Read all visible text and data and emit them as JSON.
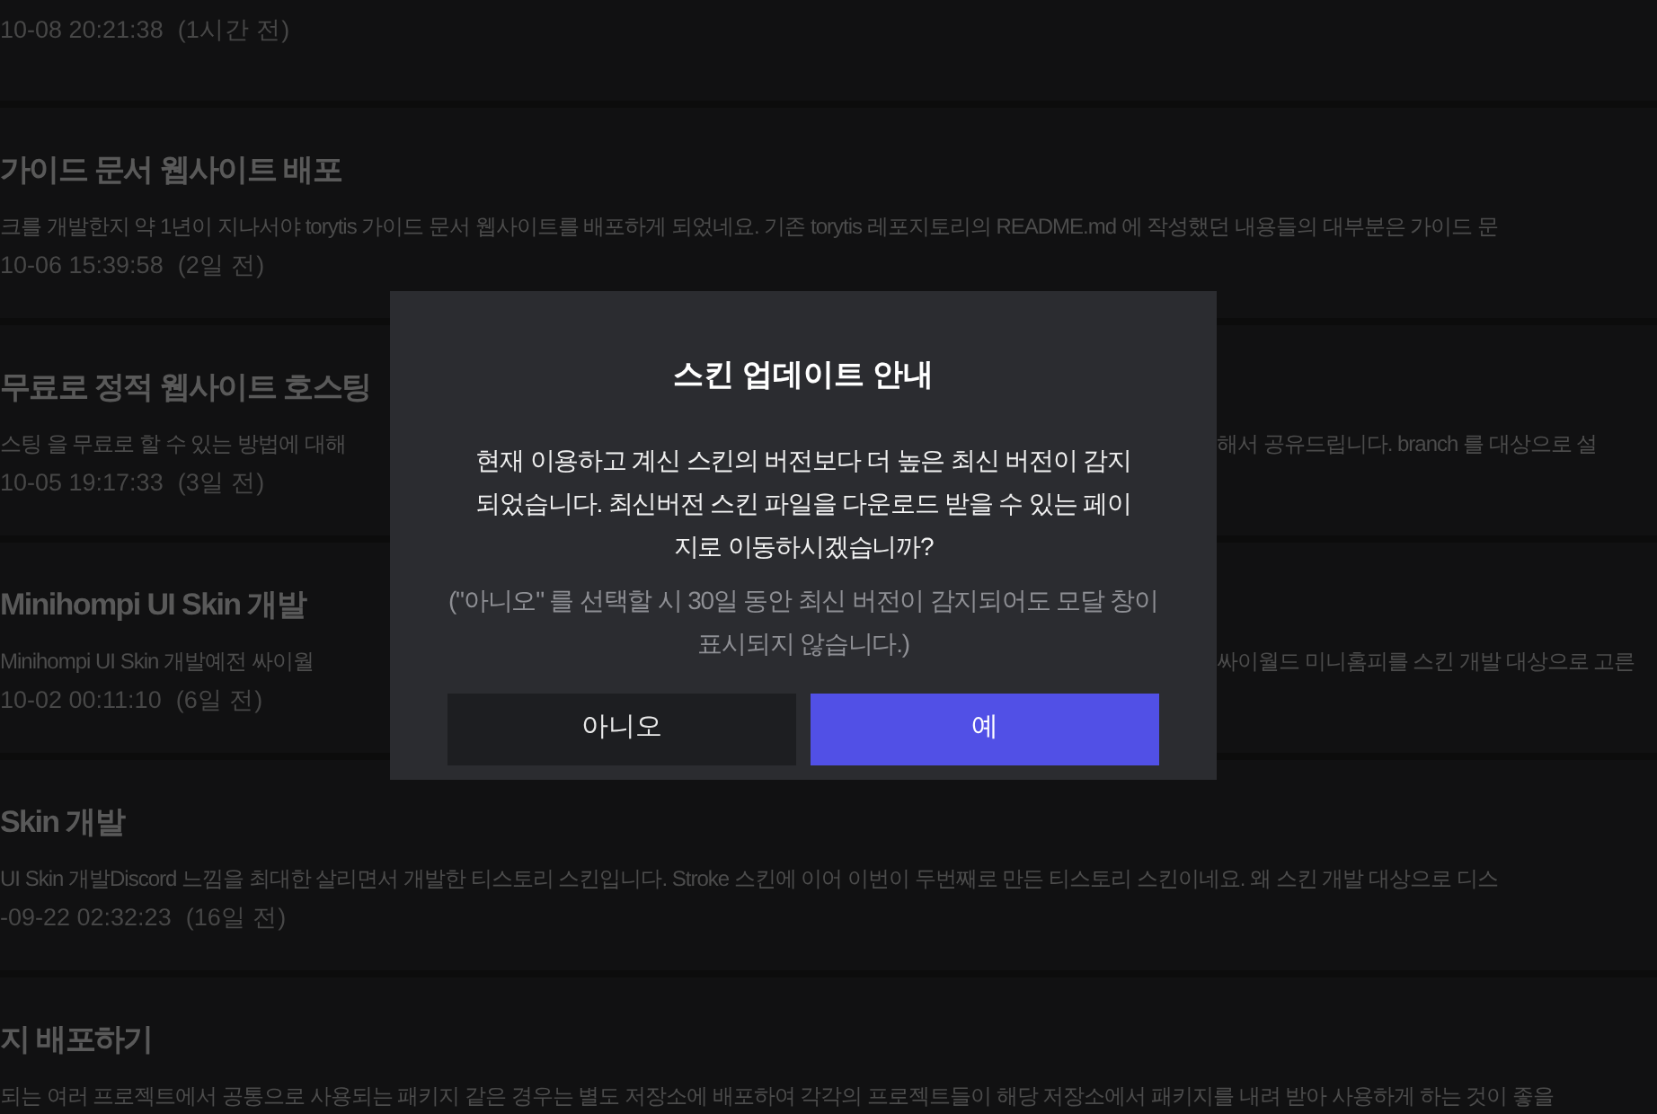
{
  "posts": [
    {
      "date": "10-08 20:21:38",
      "ago": "(1시간 전)"
    },
    {
      "title": "가이드 문서 웹사이트 배포",
      "excerpt": "크를 개발한지 약 1년이 지나서야 torytis 가이드 문서 웹사이트를 배포하게 되었네요. 기존 torytis 레포지토리의 README.md 에 작성했던 내용들의 대부분은 가이드 문",
      "date": "10-06 15:39:58",
      "ago": "(2일 전)"
    },
    {
      "title": "무료로 정적 웹사이트 호스팅",
      "excerpt_left": "스팅 을 무료로  할 수 있는 방법에 대해",
      "excerpt_right": "해서 공유드립니다. branch 를 대상으로 설",
      "date": "10-05 19:17:33",
      "ago": "(3일 전)"
    },
    {
      "title": "Minihompi UI Skin 개발",
      "excerpt_left": "Minihompi UI Skin 개발예전 싸이월",
      "excerpt_right": "싸이월드 미니홈피를 스킨 개발 대상으로 고른",
      "date": "10-02 00:11:10",
      "ago": "(6일 전)"
    },
    {
      "title": "Skin 개발",
      "excerpt": "UI Skin 개발Discord 느낌을 최대한 살리면서 개발한 티스토리 스킨입니다. Stroke 스킨에 이어 이번이 두번째로 만든 티스토리 스킨이네요. 왜 스킨 개발 대상으로 디스",
      "date": "-09-22 02:32:23",
      "ago": "(16일 전)"
    },
    {
      "title": "지 배포하기",
      "excerpt": "되는 여러 프로젝트에서 공통으로 사용되는 패키지 같은 경우는 별도 저장소에 배포하여 각각의 프로젝트들이 해당 저장소에서 패키지를 내려 받아 사용하게 하는 것이 좋을"
    }
  ],
  "modal": {
    "title": "스킨 업데이트 안내",
    "message": "현재 이용하고 계신 스킨의 버전보다 더 높은 최신 버전이 감지되었습니다. 최신버전 스킨 파일을 다운로드 받을 수 있는 페이지로 이동하시겠습니까?",
    "note": "(\"아니오\" 를 선택할 시 30일 동안 최신 버전이 감지되어도 모달 창이 표시되지 않습니다.)",
    "buttons": [
      {
        "label": "아니오",
        "kind": "secondary"
      },
      {
        "label": "예",
        "kind": "primary"
      }
    ]
  }
}
